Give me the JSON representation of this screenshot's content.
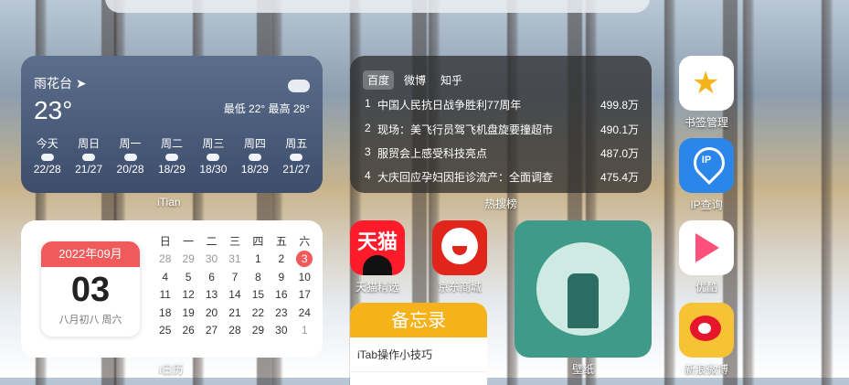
{
  "weather": {
    "location": "雨花台",
    "temperature": "23°",
    "range": "最低 22° 最高 28°",
    "days": [
      {
        "name": "今天",
        "range": "22/28"
      },
      {
        "name": "周日",
        "range": "21/27"
      },
      {
        "name": "周一",
        "range": "20/28"
      },
      {
        "name": "周二",
        "range": "18/29"
      },
      {
        "name": "周三",
        "range": "18/30"
      },
      {
        "name": "周四",
        "range": "18/29"
      },
      {
        "name": "周五",
        "range": "21/27"
      }
    ],
    "caption": "iTian"
  },
  "hot": {
    "tabs": [
      "百度",
      "微博",
      "知乎"
    ],
    "items": [
      {
        "rank": "1",
        "title": "中国人民抗日战争胜利77周年",
        "heat": "499.8万"
      },
      {
        "rank": "2",
        "title": "现场：美飞行员驾飞机盘旋要撞超市",
        "heat": "490.1万"
      },
      {
        "rank": "3",
        "title": "服贸会上感受科技亮点",
        "heat": "487.0万"
      },
      {
        "rank": "4",
        "title": "大庆回应孕妇因拒诊流产：全面调查",
        "heat": "475.4万"
      }
    ],
    "caption": "热搜榜"
  },
  "calendar": {
    "month": "2022年09月",
    "day": "03",
    "lunar": "八月初八 周六",
    "weekdays": [
      "日",
      "一",
      "二",
      "三",
      "四",
      "五",
      "六"
    ],
    "weeks": [
      [
        "28",
        "29",
        "30",
        "31",
        "1",
        "2",
        "3"
      ],
      [
        "4",
        "5",
        "6",
        "7",
        "8",
        "9",
        "10"
      ],
      [
        "11",
        "12",
        "13",
        "14",
        "15",
        "16",
        "17"
      ],
      [
        "18",
        "19",
        "20",
        "21",
        "22",
        "23",
        "24"
      ],
      [
        "25",
        "26",
        "27",
        "28",
        "29",
        "30",
        "1"
      ]
    ],
    "caption": "i日历"
  },
  "apps": {
    "tmall": {
      "label": "天猫精选",
      "icon_text": "天猫"
    },
    "jd": {
      "label": "京东商城"
    },
    "wallpaper": {
      "label": "壁纸"
    },
    "bookmarks": {
      "label": "书签管理"
    },
    "ip": {
      "label": "IP查询",
      "icon_text": "IP"
    },
    "youku": {
      "label": "优酷"
    },
    "weibo": {
      "label": "新浪微博"
    }
  },
  "memo": {
    "title": "备忘录",
    "items": [
      "iTab操作小技巧"
    ]
  },
  "colors": {
    "accent_red": "#f05a5a",
    "memo_yellow": "#f6b21b"
  }
}
